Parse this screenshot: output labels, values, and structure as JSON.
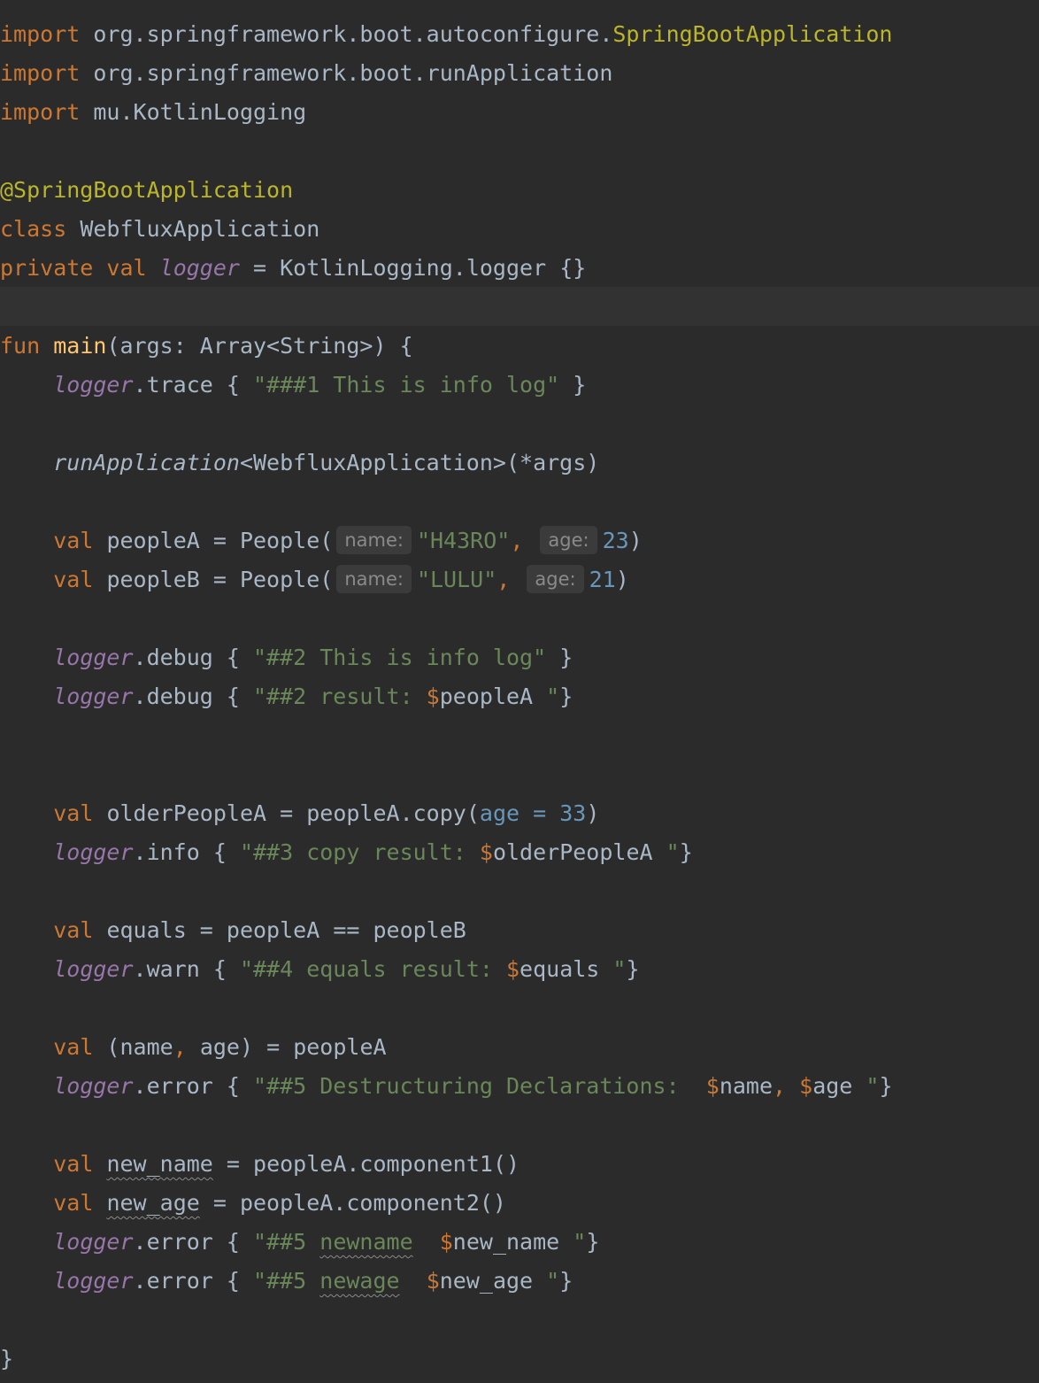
{
  "editor": {
    "imports": {
      "keyword": "import",
      "l1_pkg": "org.springframework.boot.autoconfigure.",
      "l1_cls": "SpringBootApplication",
      "l2_pkg": "org.springframework.boot.runApplication",
      "l3_pkg": "mu.KotlinLogging"
    },
    "annotation": "@SpringBootApplication",
    "class_kw": "class",
    "class_name": "WebfluxApplication",
    "private_kw": "private",
    "val_kw": "val",
    "logger_var": "logger",
    "logger_rhs": "KotlinLogging.logger",
    "braces": "{}",
    "fun_kw": "fun",
    "main_name": "main",
    "main_sig": "(args: Array<String>) {",
    "run_app": "runApplication",
    "run_app_rest": "<WebfluxApplication>(*args)",
    "people_cls": "People(",
    "hint_name": "name:",
    "hint_age": "age:",
    "peopleA_var": "peopleA",
    "peopleA_name": "\"H43RO\"",
    "peopleA_age": "23",
    "peopleB_var": "peopleB",
    "peopleB_name": "\"LULU\"",
    "peopleB_age": "21",
    "trace": ".trace",
    "debug": ".debug",
    "info": ".info",
    "warn": ".warn",
    "error": ".error",
    "s1": "\"###1 This is info log\"",
    "s2a": "\"##2 This is info log\"",
    "s2b_pre": "\"##2 result: ",
    "older_var": "olderPeopleA",
    "copy_call": "peopleA.copy(",
    "copy_param": "age = ",
    "copy_val": "33",
    "s3_pre": "\"##3 copy result: ",
    "equals_var": "equals",
    "equals_rhs": "peopleA == peopleB",
    "s4_pre": "\"##4 equals result: ",
    "destr_name": "name",
    "destr_age": "age",
    "s5_pre": "\"##5 Destructuring Declarations:  ",
    "new_name_var": "new_name",
    "new_age_var": "new_age",
    "comp1": "peopleA.component1()",
    "comp2": "peopleA.component2()",
    "s5_newname_a": "\"##5 ",
    "s5_newname_b": "newname",
    "s5_newage_b": "newage",
    "dollar": "$",
    "close_quote": " \"",
    "close_brace": "}"
  }
}
